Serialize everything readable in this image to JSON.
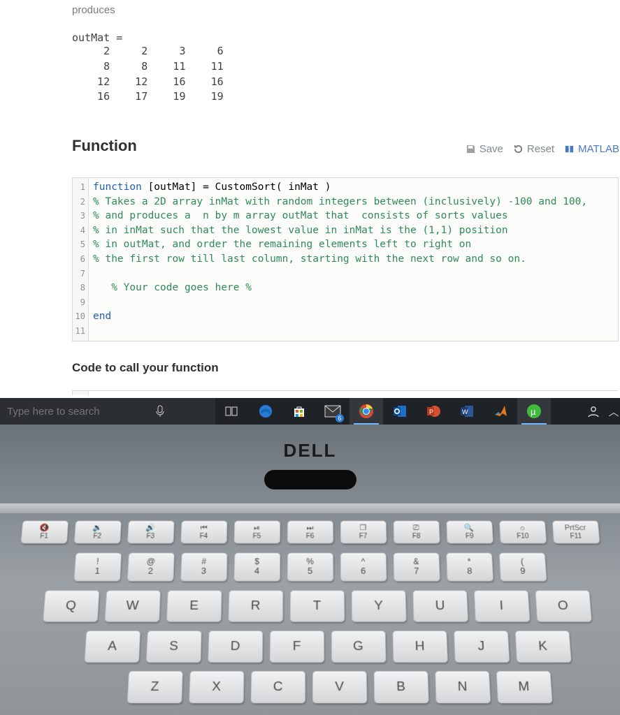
{
  "problem": {
    "produces_label": "produces",
    "outmat_label": "outMat =",
    "matrix_text": "   2     2     3     6\n   8     8    11    11\n  12    12    16    16\n  16    17    19    19"
  },
  "section": {
    "function_title": "Function",
    "call_title": "Code to call your function"
  },
  "toolbar": {
    "save": "Save",
    "reset": "Reset",
    "matlab": "MATLAB"
  },
  "code": {
    "line_numbers": [
      "1",
      "2",
      "3",
      "4",
      "5",
      "6",
      "7",
      "8",
      "9",
      "10",
      "11"
    ],
    "line1_kw": "function",
    "line1_rest": " [outMat] = CustomSort( inMat )",
    "line2": "% Takes a 2D array inMat with random integers between (inclusively) -100 and 100,",
    "line3": "% and produces a  n by m array outMat that  consists of sorts values",
    "line4": "% in inMat such that the lowest value in inMat is the (1,1) position",
    "line5": "% in outMat, and order the remaining elements left to right on",
    "line6": "% the first row till last column, starting with the next row and so on.",
    "line7": "",
    "line8": "   % Your code goes here %",
    "line9": "",
    "line10_kw": "end",
    "line11": ""
  },
  "taskbar": {
    "search_placeholder": "Type here to search",
    "mail_badge": "6"
  },
  "keyboard": {
    "frow": [
      {
        "top": "🔇",
        "bot": "F1"
      },
      {
        "top": "🔉",
        "bot": "F2"
      },
      {
        "top": "🔊",
        "bot": "F3"
      },
      {
        "top": "⏮",
        "bot": "F4"
      },
      {
        "top": "⏯",
        "bot": "F5"
      },
      {
        "top": "⏭",
        "bot": "F6"
      },
      {
        "top": "❐",
        "bot": "F7"
      },
      {
        "top": "⎚",
        "bot": "F8"
      },
      {
        "top": "🔍",
        "bot": "F9"
      },
      {
        "top": "☼",
        "bot": "F10"
      },
      {
        "top": "PrtScr",
        "bot": "F11"
      }
    ],
    "numrow": [
      {
        "top": "!",
        "bot": "1"
      },
      {
        "top": "@",
        "bot": "2"
      },
      {
        "top": "#",
        "bot": "3"
      },
      {
        "top": "$",
        "bot": "4"
      },
      {
        "top": "%",
        "bot": "5"
      },
      {
        "top": "^",
        "bot": "6"
      },
      {
        "top": "&",
        "bot": "7"
      },
      {
        "top": "*",
        "bot": "8"
      },
      {
        "top": "(",
        "bot": "9"
      }
    ],
    "qrow": [
      "Q",
      "W",
      "E",
      "R",
      "T",
      "Y",
      "U",
      "I",
      "O"
    ],
    "arow": [
      "A",
      "S",
      "D",
      "F",
      "G",
      "H",
      "J",
      "K"
    ],
    "zrow": [
      "Z",
      "X",
      "C",
      "V",
      "B",
      "N",
      "M"
    ]
  },
  "brand": "DELL"
}
